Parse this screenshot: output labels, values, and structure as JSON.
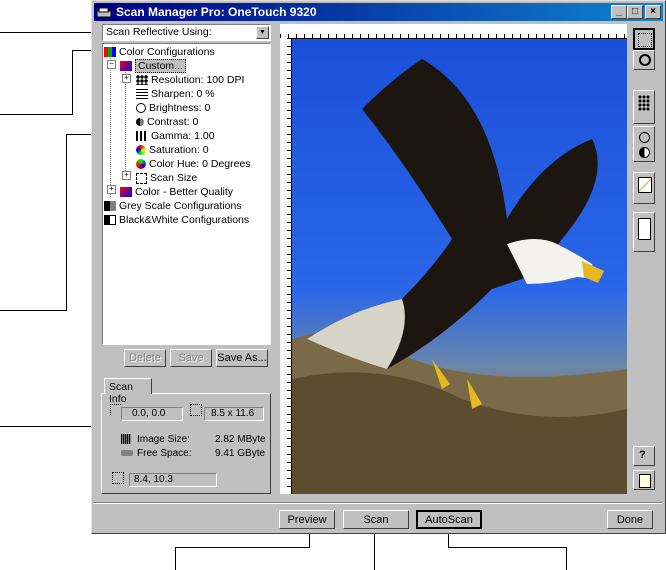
{
  "window": {
    "title": "Scan Manager Pro: OneTouch 9320",
    "minimize": "_",
    "maximize": "□",
    "close": "×"
  },
  "scan_source": {
    "value": "Scan Reflective Using:",
    "arrow": "▼"
  },
  "tree": {
    "items": [
      {
        "label": "Color Configurations",
        "icon": "color-config-icon"
      },
      {
        "label": "Custom...",
        "icon": "custom-config-icon"
      },
      {
        "label": "Resolution: 100 DPI",
        "icon": "resolution-icon"
      },
      {
        "label": "Sharpen: 0 %",
        "icon": "sharpen-icon"
      },
      {
        "label": "Brightness: 0",
        "icon": "brightness-icon"
      },
      {
        "label": "Contrast: 0",
        "icon": "contrast-icon"
      },
      {
        "label": "Gamma: 1.00",
        "icon": "gamma-icon"
      },
      {
        "label": "Saturation: 0",
        "icon": "saturation-icon"
      },
      {
        "label": "Color Hue: 0 Degrees",
        "icon": "color-hue-icon"
      },
      {
        "label": "Scan Size",
        "icon": "scan-size-icon"
      },
      {
        "label": "Color - Better Quality",
        "icon": "color-quality-icon"
      },
      {
        "label": "Grey Scale Configurations",
        "icon": "grey-config-icon"
      },
      {
        "label": "Black&White Configurations",
        "icon": "bw-config-icon"
      }
    ]
  },
  "config_buttons": {
    "delete": "Delete",
    "save": "Save",
    "save_as": "Save As..."
  },
  "scan_info": {
    "tab": "Scan Info",
    "origin": "0.0, 0.0",
    "size": "8.5 x 11.6",
    "image_size_label": "Image Size:",
    "image_size_value": "2.82 MByte",
    "free_space_label": "Free Space:",
    "free_space_value": "9.41 GByte",
    "cursor": "8.4, 10.3"
  },
  "bottom_buttons": {
    "preview": "Preview",
    "scan": "Scan",
    "autoscan": "AutoScan",
    "done": "Done"
  },
  "colors": {
    "title_start": "#000080",
    "title_end": "#1084d0",
    "face": "#c0c0c0"
  }
}
